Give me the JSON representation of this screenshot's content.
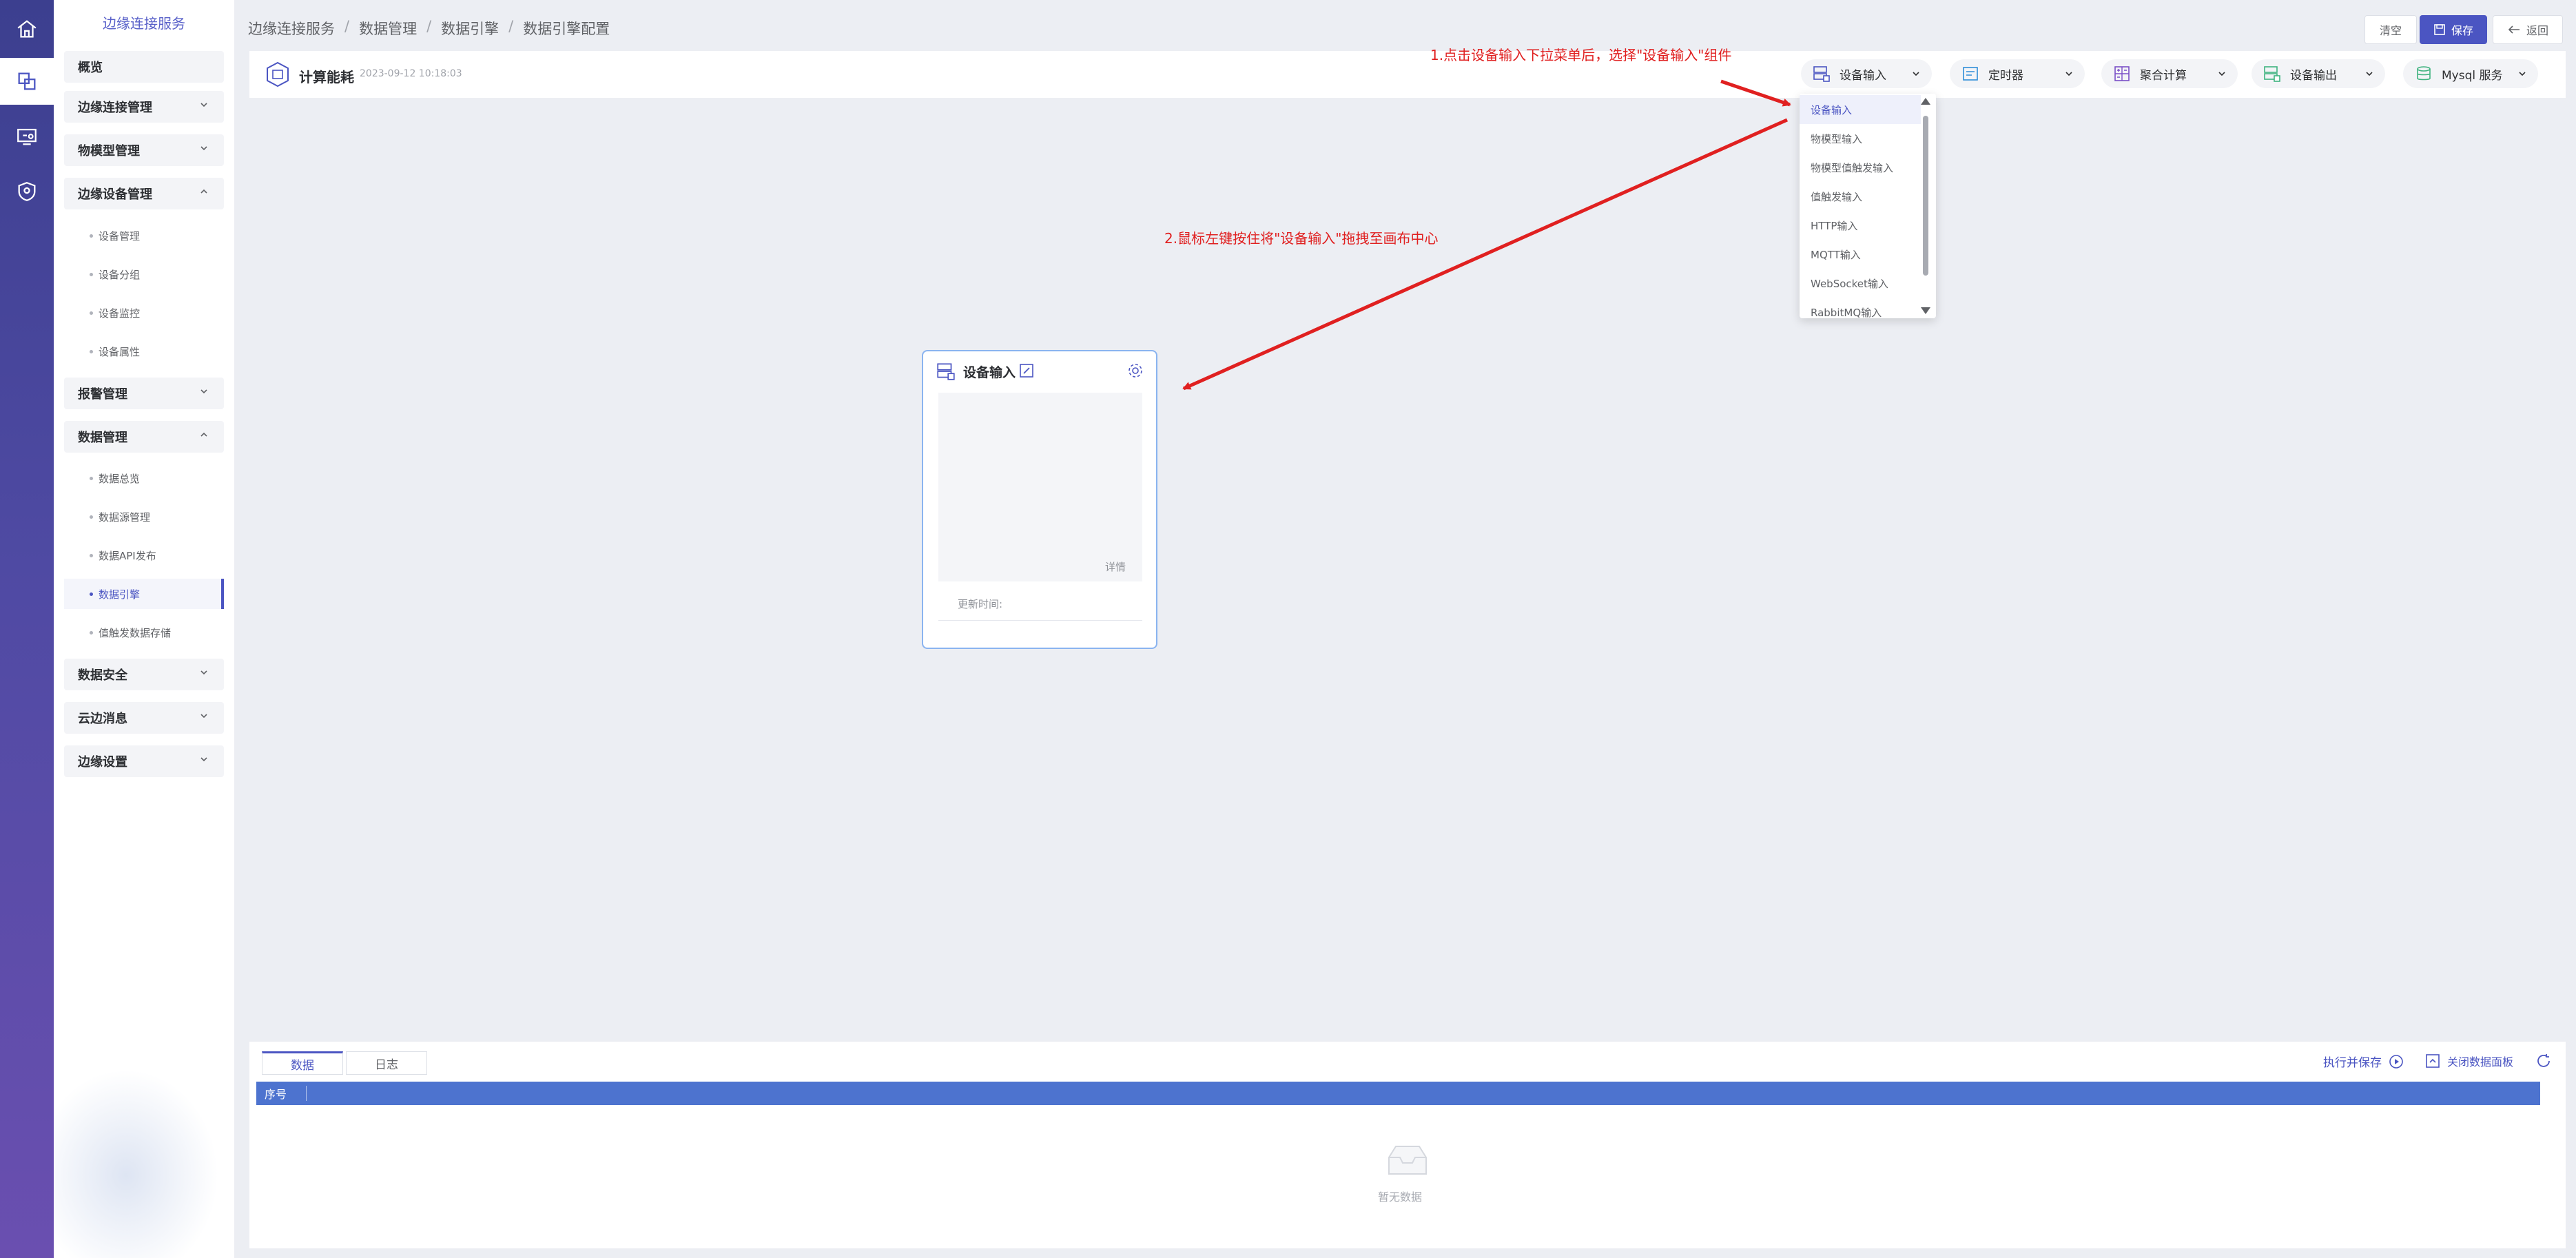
{
  "sidebar": {
    "title": "边缘连接服务",
    "items": [
      {
        "label": "概览"
      },
      {
        "label": "边缘连接管理"
      },
      {
        "label": "物模型管理"
      },
      {
        "label": "边缘设备管理"
      },
      {
        "label": "设备管理"
      },
      {
        "label": "设备分组"
      },
      {
        "label": "设备监控"
      },
      {
        "label": "设备属性"
      },
      {
        "label": "报警管理"
      },
      {
        "label": "数据管理"
      },
      {
        "label": "数据总览"
      },
      {
        "label": "数据源管理"
      },
      {
        "label": "数据API发布"
      },
      {
        "label": "数据引擎"
      },
      {
        "label": "值触发数据存储"
      },
      {
        "label": "数据安全"
      },
      {
        "label": "云边消息"
      },
      {
        "label": "边缘设置"
      }
    ]
  },
  "breadcrumb": [
    "边缘连接服务",
    "数据管理",
    "数据引擎",
    "数据引擎配置"
  ],
  "header_buttons": {
    "clear": "清空",
    "save": "保存",
    "back": "返回"
  },
  "flow": {
    "name": "计算能耗",
    "time": "2023-09-12 10:18:03"
  },
  "toolbar": [
    {
      "label": "设备输入",
      "icon": "device-input-icon"
    },
    {
      "label": "定时器",
      "icon": "timer-icon"
    },
    {
      "label": "聚合计算",
      "icon": "aggregate-icon"
    },
    {
      "label": "设备输出",
      "icon": "device-output-icon"
    },
    {
      "label": "Mysql 服务",
      "icon": "database-icon"
    }
  ],
  "dropdown": [
    "设备输入",
    "物模型输入",
    "物模型值触发输入",
    "值触发输入",
    "HTTP输入",
    "MQTT输入",
    "WebSocket输入",
    "RabbitMQ输入"
  ],
  "annotations": {
    "step1": "1.点击设备输入下拉菜单后，选择\"设备输入\"组件",
    "step2": "2.鼠标左键按住将\"设备输入\"拖拽至画布中心"
  },
  "node": {
    "title": "设备输入",
    "detail": "详情",
    "update_label": "更新时间:"
  },
  "bottom_panel": {
    "tabs": [
      "数据",
      "日志"
    ],
    "column_header": "序号",
    "execute_save": "执行并保存",
    "close_panel": "关闭数据面板",
    "empty_text": "暂无数据"
  },
  "colors": {
    "accent": "#4b55c2",
    "annotation": "#e02020",
    "table_header": "#4d73cf"
  }
}
